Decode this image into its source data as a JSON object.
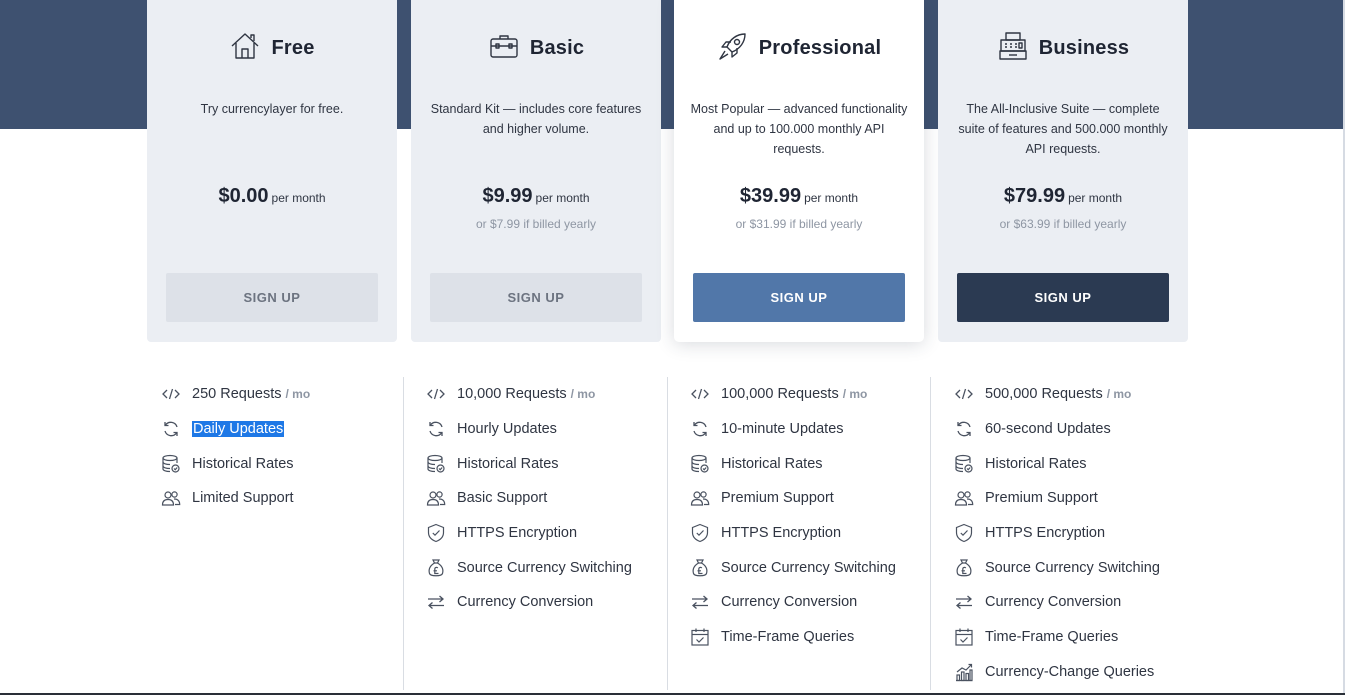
{
  "plans": [
    {
      "name": "Free",
      "icon": "house-icon",
      "description": "Try currencylayer for free.",
      "price": "$0.00",
      "per": "per month",
      "yearly": "",
      "button": "SIGN UP",
      "features": [
        {
          "icon": "code-icon",
          "label": "250 Requests",
          "unit": "/ mo"
        },
        {
          "icon": "refresh-icon",
          "label": "Daily Updates",
          "selected": true
        },
        {
          "icon": "database-icon",
          "label": "Historical Rates"
        },
        {
          "icon": "users-icon",
          "label": "Limited Support"
        }
      ]
    },
    {
      "name": "Basic",
      "icon": "briefcase-icon",
      "description": "Standard Kit — includes core features and higher volume.",
      "price": "$9.99",
      "per": "per month",
      "yearly": "or $7.99 if billed yearly",
      "button": "SIGN UP",
      "features": [
        {
          "icon": "code-icon",
          "label": "10,000 Requests",
          "unit": "/ mo"
        },
        {
          "icon": "refresh-icon",
          "label": "Hourly Updates"
        },
        {
          "icon": "database-icon",
          "label": "Historical Rates"
        },
        {
          "icon": "users-icon",
          "label": "Basic Support"
        },
        {
          "icon": "shield-icon",
          "label": "HTTPS Encryption"
        },
        {
          "icon": "money-bag-icon",
          "label": "Source Currency Switching"
        },
        {
          "icon": "exchange-arrows-icon",
          "label": "Currency Conversion"
        }
      ]
    },
    {
      "name": "Professional",
      "icon": "rocket-icon",
      "description": "Most Popular — advanced functionality and up to 100.000 monthly API requests.",
      "price": "$39.99",
      "per": "per month",
      "yearly": "or $31.99 if billed yearly",
      "button": "SIGN UP",
      "features": [
        {
          "icon": "code-icon",
          "label": "100,000 Requests",
          "unit": "/ mo"
        },
        {
          "icon": "refresh-icon",
          "label": "10-minute Updates"
        },
        {
          "icon": "database-icon",
          "label": "Historical Rates"
        },
        {
          "icon": "users-icon",
          "label": "Premium Support"
        },
        {
          "icon": "shield-icon",
          "label": "HTTPS Encryption"
        },
        {
          "icon": "money-bag-icon",
          "label": "Source Currency Switching"
        },
        {
          "icon": "exchange-arrows-icon",
          "label": "Currency Conversion"
        },
        {
          "icon": "calendar-check-icon",
          "label": "Time-Frame Queries"
        }
      ]
    },
    {
      "name": "Business",
      "icon": "cash-register-icon",
      "description": "The All-Inclusive Suite — complete suite of features and 500.000 monthly API requests.",
      "price": "$79.99",
      "per": "per month",
      "yearly": "or $63.99 if billed yearly",
      "button": "SIGN UP",
      "features": [
        {
          "icon": "code-icon",
          "label": "500,000 Requests",
          "unit": "/ mo"
        },
        {
          "icon": "refresh-icon",
          "label": "60-second Updates"
        },
        {
          "icon": "database-icon",
          "label": "Historical Rates"
        },
        {
          "icon": "users-icon",
          "label": "Premium Support"
        },
        {
          "icon": "shield-icon",
          "label": "HTTPS Encryption"
        },
        {
          "icon": "money-bag-icon",
          "label": "Source Currency Switching"
        },
        {
          "icon": "exchange-arrows-icon",
          "label": "Currency Conversion"
        },
        {
          "icon": "calendar-check-icon",
          "label": "Time-Frame Queries"
        },
        {
          "icon": "bar-chart-icon",
          "label": "Currency-Change Queries"
        }
      ]
    }
  ],
  "colors": {
    "header_band": "#3e5170",
    "card_bg": "#ebeef3",
    "button_light": "#dde1e8",
    "button_blue": "#5177a9",
    "button_dark": "#2b3a52",
    "selection": "#1e78e6"
  }
}
